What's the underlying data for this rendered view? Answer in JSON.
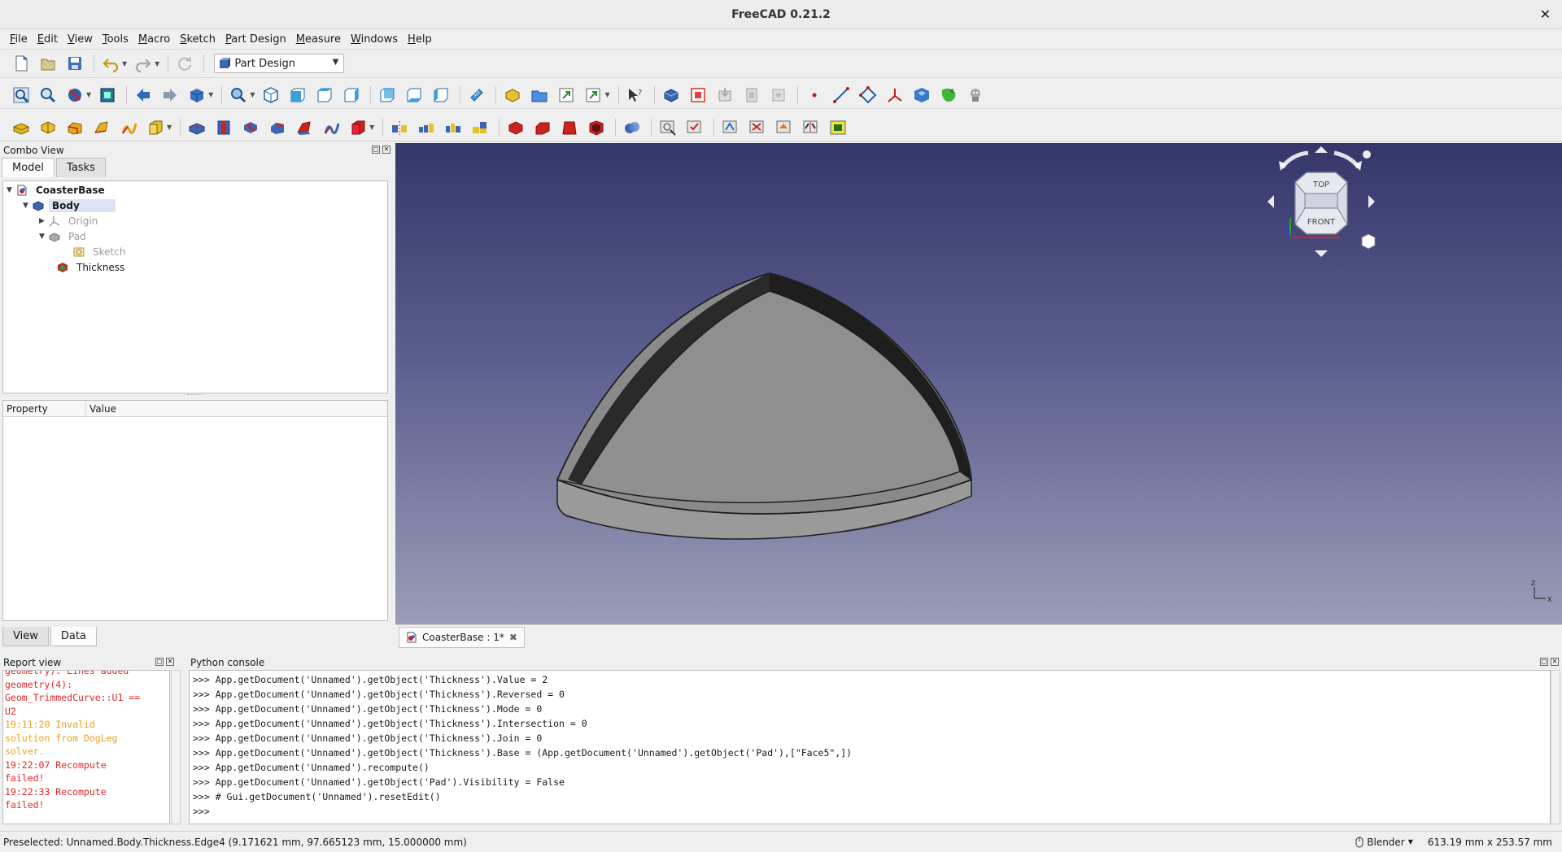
{
  "window": {
    "title": "FreeCAD 0.21.2"
  },
  "menu": [
    "File",
    "Edit",
    "View",
    "Tools",
    "Macro",
    "Sketch",
    "Part Design",
    "Measure",
    "Windows",
    "Help"
  ],
  "workbench": {
    "selected": "Part Design"
  },
  "combo_view": {
    "title": "Combo View",
    "tabs": [
      "Model",
      "Tasks"
    ],
    "tree": {
      "document": "CoasterBase",
      "body": "Body",
      "origin": "Origin",
      "pad": "Pad",
      "sketch": "Sketch",
      "thickness": "Thickness"
    },
    "property_headers": [
      "Property",
      "Value"
    ],
    "bottom_tabs": [
      "View",
      "Data"
    ]
  },
  "document_tab": {
    "label": "CoasterBase : 1*"
  },
  "navcube": {
    "top": "TOP",
    "front": "FRONT"
  },
  "axis": {
    "z": "Z",
    "x": "X"
  },
  "report_view": {
    "title": "Report view",
    "lines": [
      {
        "text": "geometry): Lines added",
        "type": "err"
      },
      {
        "text": "geometry(4):",
        "type": "err"
      },
      {
        "text": "Geom_TrimmedCurve::U1 ==",
        "type": "err"
      },
      {
        "text": "U2",
        "type": "err"
      },
      {
        "text": "19:11:20  Invalid",
        "type": "warn"
      },
      {
        "text": "solution from DogLeg",
        "type": "warn"
      },
      {
        "text": "solver.",
        "type": "warn"
      },
      {
        "text": "19:22:07  Recompute",
        "type": "err"
      },
      {
        "text": "failed!",
        "type": "err"
      },
      {
        "text": "19:22:33  Recompute",
        "type": "err"
      },
      {
        "text": "failed!",
        "type": "err"
      }
    ]
  },
  "python_console": {
    "title": "Python console",
    "lines": [
      ">>> App.getDocument('Unnamed').getObject('Thickness').Value = 2",
      ">>> App.getDocument('Unnamed').getObject('Thickness').Reversed = 0",
      ">>> App.getDocument('Unnamed').getObject('Thickness').Mode = 0",
      ">>> App.getDocument('Unnamed').getObject('Thickness').Intersection = 0",
      ">>> App.getDocument('Unnamed').getObject('Thickness').Join = 0",
      ">>> App.getDocument('Unnamed').getObject('Thickness').Base = (App.getDocument('Unnamed').getObject('Pad'),[\"Face5\",])",
      ">>> App.getDocument('Unnamed').recompute()",
      ">>> App.getDocument('Unnamed').getObject('Pad').Visibility = False",
      ">>> # Gui.getDocument('Unnamed').resetEdit()",
      ">>>"
    ]
  },
  "status": {
    "preselected": "Preselected: Unnamed.Body.Thickness.Edge4 (9.171621 mm, 97.665123 mm, 15.000000 mm)",
    "navigation": "Blender",
    "dimensions": "613.19 mm x 253.57 mm"
  },
  "colors": {
    "view_top": "#35366a",
    "view_bottom": "#9a9cb8",
    "error": "#e0262a",
    "warning": "#e9a21b"
  }
}
